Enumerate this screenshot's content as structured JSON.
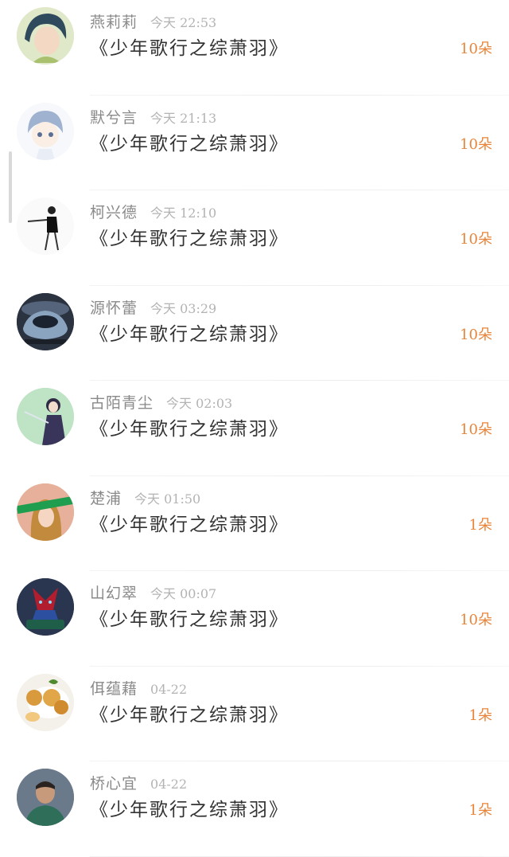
{
  "messages": [
    {
      "user": "燕莉莉",
      "time": "今天 22:53",
      "title": "《少年歌行之综萧羽》",
      "count": "10朵",
      "avatar_icon": "anime-boy-avatar-icon",
      "avatar_bg": "#dfe8c8"
    },
    {
      "user": "默兮言",
      "time": "今天 21:13",
      "title": "《少年歌行之综萧羽》",
      "count": "10朵",
      "avatar_icon": "chibi-blue-hair-avatar-icon",
      "avatar_bg": "#f7f8fb"
    },
    {
      "user": "柯兴德",
      "time": "今天 12:10",
      "title": "《少年歌行之综萧羽》",
      "count": "10朵",
      "avatar_icon": "sketch-figure-avatar-icon",
      "avatar_bg": "#fafafa"
    },
    {
      "user": "源怀蕾",
      "time": "今天 03:29",
      "title": "《少年歌行之综萧羽》",
      "count": "10朵",
      "avatar_icon": "concept-car-avatar-icon",
      "avatar_bg": "#2b3340"
    },
    {
      "user": "古陌青尘",
      "time": "今天 02:03",
      "title": "《少年歌行之综萧羽》",
      "count": "10朵",
      "avatar_icon": "anime-swordsman-avatar-icon",
      "avatar_bg": "#bfe3c5"
    },
    {
      "user": "楚浦",
      "time": "今天 01:50",
      "title": "《少年歌行之综萧羽》",
      "count": "1朵",
      "avatar_icon": "girl-photo-avatar-icon",
      "avatar_bg": "#e7b09a"
    },
    {
      "user": "山幻翠",
      "time": "今天 00:07",
      "title": "《少年歌行之综萧羽》",
      "count": "10朵",
      "avatar_icon": "robot-hero-avatar-icon",
      "avatar_bg": "#2a3550"
    },
    {
      "user": "佴蕴藉",
      "time": "04-22",
      "title": "《少年歌行之综萧羽》",
      "count": "1朵",
      "avatar_icon": "fried-food-avatar-icon",
      "avatar_bg": "#f4f1ea"
    },
    {
      "user": "桥心宜",
      "time": "04-22",
      "title": "《少年歌行之综萧羽》",
      "count": "1朵",
      "avatar_icon": "man-portrait-avatar-icon",
      "avatar_bg": "#6b7a8a"
    }
  ],
  "colors": {
    "accent": "#e8853a",
    "username": "#8a8a8a",
    "time": "#b3b3b3",
    "title": "#333333"
  }
}
